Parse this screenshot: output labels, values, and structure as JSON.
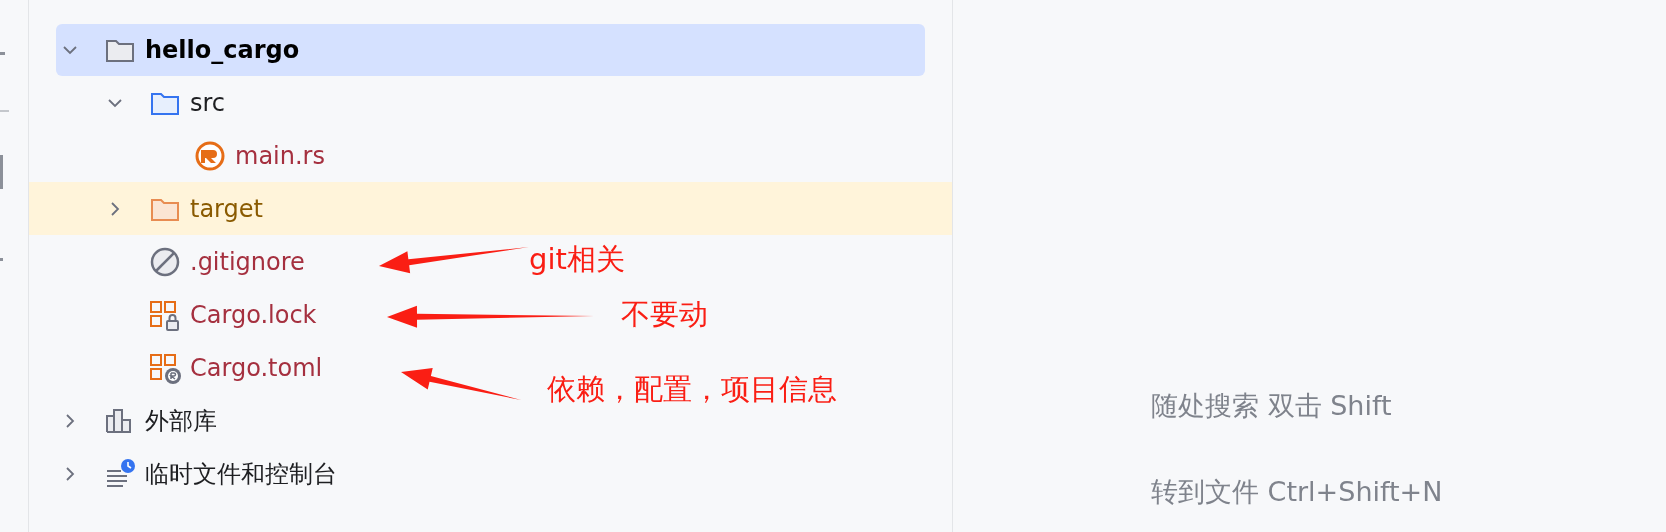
{
  "project_tree": [
    {
      "label": "hello_cargo",
      "kind": "folder",
      "expanded": true,
      "selected": true,
      "excluded": false,
      "color": "#000000",
      "bold": true,
      "children": [
        {
          "label": "src",
          "kind": "source-folder",
          "expanded": true,
          "selected": false,
          "excluded": false,
          "color": "#1e1f22",
          "children": [
            {
              "label": "main.rs",
              "kind": "rust-file",
              "selected": false,
              "excluded": false,
              "color": "#a5303f"
            }
          ]
        },
        {
          "label": "target",
          "kind": "excluded-folder",
          "expanded": false,
          "selected": false,
          "excluded": true,
          "color": "#8a5a00"
        },
        {
          "label": ".gitignore",
          "kind": "ignore-file",
          "selected": false,
          "excluded": false,
          "color": "#a5303f"
        },
        {
          "label": "Cargo.lock",
          "kind": "cargo-lock",
          "selected": false,
          "excluded": false,
          "color": "#a5303f"
        },
        {
          "label": "Cargo.toml",
          "kind": "cargo-toml",
          "selected": false,
          "excluded": false,
          "color": "#a5303f"
        }
      ]
    },
    {
      "label": "外部库",
      "kind": "library",
      "expanded": false,
      "selected": false,
      "excluded": false,
      "color": "#1e1f22"
    },
    {
      "label": "临时文件和控制台",
      "kind": "scratches",
      "expanded": false,
      "selected": false,
      "excluded": false,
      "color": "#1e1f22"
    }
  ],
  "annotations": [
    {
      "text": "git相关"
    },
    {
      "text": "不要动"
    },
    {
      "text": "依赖，配置，项目信息"
    }
  ],
  "editor_hints": [
    "随处搜索 双击 Shift",
    "转到文件 Ctrl+Shift+N"
  ]
}
